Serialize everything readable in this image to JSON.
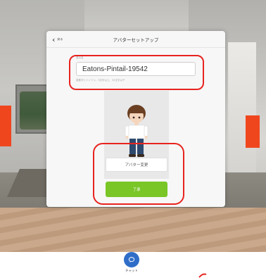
{
  "dialog": {
    "back_label": "戻る",
    "title": "アバターセットアップ",
    "name_label": "表示名",
    "name_value": "Eatons-Pintail-19542",
    "name_hint": "英数字とハイフン、3文字以上、32文字以下",
    "change_avatar_label": "アバター変更",
    "ok_label": "了承"
  },
  "bottom_bar": {
    "chat_label": "チャット"
  },
  "colors": {
    "accent_green": "#79c626",
    "highlight_red": "#e8231f",
    "chat_blue": "#2f6ec8",
    "marker_orange": "#f0461e"
  },
  "icons": {
    "back": "chevron-left-icon",
    "chat": "chat-bubble-icon"
  }
}
